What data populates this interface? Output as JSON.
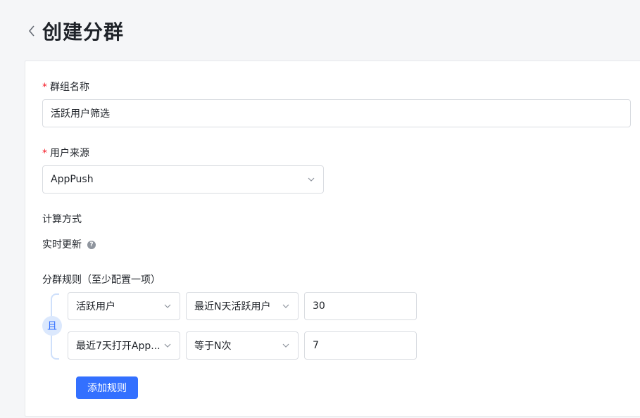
{
  "header": {
    "title": "创建分群"
  },
  "form": {
    "group_name": {
      "label": "群组名称",
      "value": "活跃用户筛选"
    },
    "user_source": {
      "label": "用户来源",
      "value": "AppPush"
    },
    "calc_method": {
      "label": "计算方式",
      "value": "实时更新",
      "help": "?"
    },
    "rules": {
      "label": "分群规则（至少配置一项）",
      "connector": "且",
      "items": [
        {
          "field": "活跃用户",
          "operator": "最近N天活跃用户",
          "value": "30"
        },
        {
          "field": "最近7天打开App...",
          "operator": "等于N次",
          "value": "7"
        }
      ],
      "add_button": "添加规则"
    }
  },
  "colors": {
    "primary": "#3370ff",
    "required": "#f5222d",
    "border": "#d9dce1"
  },
  "icons": {
    "back": "chevron-left-icon",
    "dropdown": "chevron-down-icon",
    "help": "question-circle-icon"
  }
}
